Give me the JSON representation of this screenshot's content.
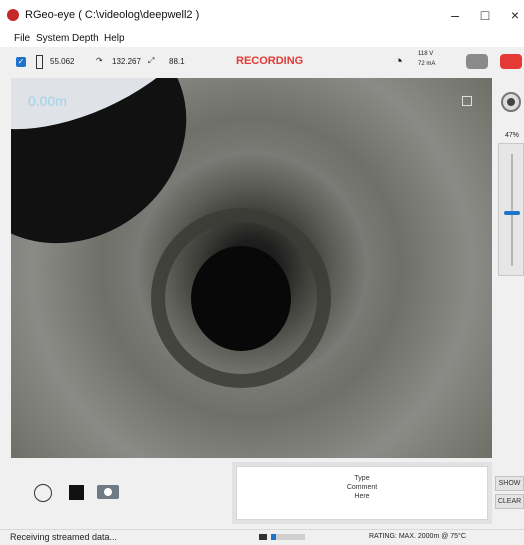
{
  "window": {
    "title": "RGeo-eye ( C:\\videolog\\deepwell2 )"
  },
  "menu": {
    "items": [
      "File",
      "System",
      "Depth",
      "Help"
    ]
  },
  "toolbar": {
    "checkbox_checked": true,
    "battery_value": "55.062",
    "tilt_value": "132.267",
    "angle_value": "88.1",
    "recording_label": "RECORDING",
    "voltage": "118 V",
    "current": "72 mA"
  },
  "video": {
    "depth": "0.00m",
    "brightness_pct": "47%",
    "brightness_value": 0.47
  },
  "controls": {
    "comment_placeholder": "Type\nComment\nHere",
    "show_label": "SHOW",
    "clear_label": "CLEAR"
  },
  "status": {
    "left": "Receiving streamed data...",
    "progress": 0.14,
    "right": "RATING: MAX. 2000m @ 75°C"
  },
  "colors": {
    "accent": "#1f73c8",
    "recording": "#e53935",
    "record_button": "#e53935"
  }
}
